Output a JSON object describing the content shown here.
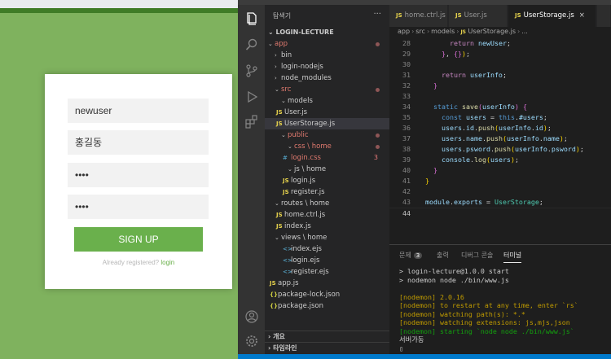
{
  "login_page": {
    "fields": [
      {
        "name": "id",
        "value": "newuser"
      },
      {
        "name": "name",
        "value": "홍길동"
      },
      {
        "name": "password",
        "value": "••••"
      },
      {
        "name": "confirm_password",
        "value": "••••"
      }
    ],
    "signup_label": "SIGN UP",
    "already_text": "Already registered?",
    "login_link": "login"
  },
  "vscode": {
    "explorer": {
      "title": "탐색기",
      "more": "···",
      "root": "LOGIN-LECTURE",
      "items": [
        {
          "label": "app",
          "type": "folder-open",
          "color": "red",
          "dot": true
        },
        {
          "label": "bin",
          "type": "folder"
        },
        {
          "label": "login-nodejs",
          "type": "folder"
        },
        {
          "label": "node_modules",
          "type": "folder"
        },
        {
          "label": "src",
          "type": "folder-open",
          "color": "red",
          "dot": true
        },
        {
          "label": "models",
          "type": "folder-open"
        },
        {
          "label": "User.js",
          "type": "js"
        },
        {
          "label": "UserStorage.js",
          "type": "js",
          "selected": true
        },
        {
          "label": "public",
          "type": "folder-open",
          "color": "red",
          "dot": true
        },
        {
          "label": "css \\ home",
          "type": "folder-open",
          "color": "red",
          "dot": true
        },
        {
          "label": "login.css",
          "type": "css",
          "color": "red",
          "badge": "3"
        },
        {
          "label": "js \\ home",
          "type": "folder-open"
        },
        {
          "label": "login.js",
          "type": "js"
        },
        {
          "label": "register.js",
          "type": "js"
        },
        {
          "label": "routes \\ home",
          "type": "folder-open"
        },
        {
          "label": "home.ctrl.js",
          "type": "js"
        },
        {
          "label": "index.js",
          "type": "js"
        },
        {
          "label": "views \\ home",
          "type": "folder-open"
        },
        {
          "label": "index.ejs",
          "type": "ejs"
        },
        {
          "label": "login.ejs",
          "type": "ejs"
        },
        {
          "label": "register.ejs",
          "type": "ejs"
        },
        {
          "label": "app.js",
          "type": "js"
        },
        {
          "label": "package-lock.json",
          "type": "json"
        },
        {
          "label": "package.json",
          "type": "json"
        }
      ],
      "outline": "개요",
      "timeline": "타임라인"
    },
    "tabs": [
      {
        "label": "home.ctrl.js"
      },
      {
        "label": "User.js"
      },
      {
        "label": "UserStorage.js",
        "active": true,
        "close": "×"
      }
    ],
    "breadcrumb": [
      "app",
      "src",
      "models",
      "UserStorage.js",
      "..."
    ],
    "code_lines": [
      {
        "n": "28",
        "text": "return newUser;"
      },
      {
        "n": "29",
        "text": "}, {});"
      },
      {
        "n": "30",
        "text": ""
      },
      {
        "n": "31",
        "text": "return userInfo;"
      },
      {
        "n": "32",
        "text": "}"
      },
      {
        "n": "33",
        "text": ""
      },
      {
        "n": "34",
        "text": "static save(userInfo) {"
      },
      {
        "n": "35",
        "text": "const users = this.#users;"
      },
      {
        "n": "36",
        "text": "users.id.push(userInfo.id);"
      },
      {
        "n": "37",
        "text": "users.name.push(userInfo.name);"
      },
      {
        "n": "38",
        "text": "users.psword.push(userInfo.psword);"
      },
      {
        "n": "39",
        "text": "console.log(users);"
      },
      {
        "n": "40",
        "text": "}"
      },
      {
        "n": "41",
        "text": "}"
      },
      {
        "n": "42",
        "text": ""
      },
      {
        "n": "43",
        "text": "module.exports = UserStorage;"
      },
      {
        "n": "44",
        "text": ""
      }
    ],
    "panel": {
      "tabs": [
        {
          "label": "문제",
          "count": "3"
        },
        {
          "label": "출력"
        },
        {
          "label": "디버그 콘솔"
        },
        {
          "label": "터미널",
          "active": true
        }
      ],
      "terminal": [
        {
          "text": "> login-lecture@1.0.0 start",
          "color": "default"
        },
        {
          "text": "> nodemon node ./bin/www.js",
          "color": "default"
        },
        {
          "text": "",
          "color": "default"
        },
        {
          "text": "[nodemon] 2.0.16",
          "color": "yellow"
        },
        {
          "text": "[nodemon] to restart at any time, enter `rs`",
          "color": "yellow"
        },
        {
          "text": "[nodemon] watching path(s): *.*",
          "color": "yellow"
        },
        {
          "text": "[nodemon] watching extensions: js,mjs,json",
          "color": "yellow"
        },
        {
          "text": "[nodemon] starting `node node ./bin/www.js`",
          "color": "green"
        },
        {
          "text": "서버가동",
          "color": "default"
        },
        {
          "text": "▯",
          "color": "default"
        }
      ]
    }
  }
}
